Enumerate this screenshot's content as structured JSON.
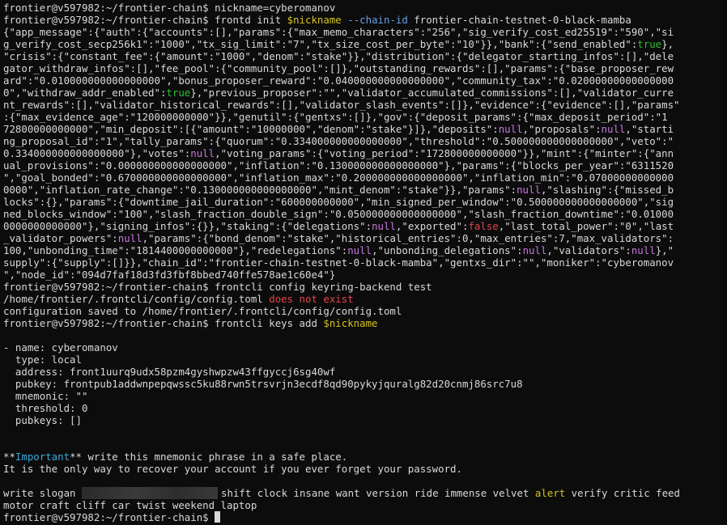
{
  "terminal": {
    "segments": [
      [
        "frontier@v597982:~/frontier-chain$ nickname=cyberomanov"
      ],
      [
        "frontier@v597982:~/frontier-chain$ frontd init ",
        {
          "t": "$nickname",
          "c": "var"
        },
        " ",
        {
          "t": "--chain-id",
          "c": "flag"
        },
        " frontier-chain-testnet-0-black-mamba"
      ],
      [
        "{\"app_message\":{\"auth\":{\"accounts\":[],\"params\":{\"max_memo_characters\":\"256\",\"sig_verify_cost_ed25519\":\"590\",\"si"
      ],
      [
        "g_verify_cost_secp256k1\":\"1000\",\"tx_sig_limit\":\"7\",\"tx_size_cost_per_byte\":\"10\"}},\"bank\":{\"send_enabled\":",
        {
          "t": "true",
          "c": "bool"
        },
        "},"
      ],
      [
        "\"crisis\":{\"constant_fee\":{\"amount\":\"1000\",\"denom\":\"stake\"}},\"distribution\":{\"delegator_starting_infos\":[],\"dele"
      ],
      [
        "gator_withdraw_infos\":[],\"fee_pool\":{\"community_pool\":[]},\"outstanding_rewards\":[],\"params\":{\"base_proposer_rew"
      ],
      [
        "ard\":\"0.010000000000000000\",\"bonus_proposer_reward\":\"0.040000000000000000\",\"community_tax\":\"0.02000000000000000"
      ],
      [
        "0\",\"withdraw_addr_enabled\":",
        {
          "t": "true",
          "c": "bool"
        },
        "},\"previous_proposer\":\"\",\"validator_accumulated_commissions\":[],\"validator_curre"
      ],
      [
        "nt_rewards\":[],\"validator_historical_rewards\":[],\"validator_slash_events\":[]},\"evidence\":{\"evidence\":[],\"params\""
      ],
      [
        ":{\"max_evidence_age\":\"120000000000\"}},\"genutil\":{\"gentxs\":[]},\"gov\":{\"deposit_params\":{\"max_deposit_period\":\"1"
      ],
      [
        "72800000000000\",\"min_deposit\":[{\"amount\":\"10000000\",\"denom\":\"stake\"}]},\"deposits\":",
        {
          "t": "null",
          "c": "nul"
        },
        ",\"proposals\":",
        {
          "t": "null",
          "c": "nul"
        },
        ",\"starti"
      ],
      [
        "ng_proposal_id\":\"1\",\"tally_params\":{\"quorum\":\"0.334000000000000000\",\"threshold\":\"0.500000000000000000\",\"veto\":\""
      ],
      [
        "0.334000000000000000\"},\"votes\":",
        {
          "t": "null",
          "c": "nul"
        },
        ",\"voting_params\":{\"voting_period\":\"172800000000000\"}},\"mint\":{\"minter\":{\"ann"
      ],
      [
        "ual_provisions\":\"0.000000000000000000\",\"inflation\":\"0.130000000000000000\"},\"params\":{\"blocks_per_year\":\"6311520"
      ],
      [
        "\",\"goal_bonded\":\"0.670000000000000000\",\"inflation_max\":\"0.200000000000000000\",\"inflation_min\":\"0.07000000000000"
      ],
      [
        "0000\",\"inflation_rate_change\":\"0.130000000000000000\",\"mint_denom\":\"stake\"}},\"params\":",
        {
          "t": "null",
          "c": "nul"
        },
        ",\"slashing\":{\"missed_b"
      ],
      [
        "locks\":{},\"params\":{\"downtime_jail_duration\":\"600000000000\",\"min_signed_per_window\":\"0.500000000000000000\",\"sig"
      ],
      [
        "ned_blocks_window\":\"100\",\"slash_fraction_double_sign\":\"0.050000000000000000\",\"slash_fraction_downtime\":\"0.01000"
      ],
      [
        "0000000000000\"},\"signing_infos\":{}},\"staking\":{\"delegations\":",
        {
          "t": "null",
          "c": "nul"
        },
        ",\"exported\":",
        {
          "t": "false",
          "c": "fals"
        },
        ",\"last_total_power\":\"0\",\"last"
      ],
      [
        "_validator_powers\":",
        {
          "t": "null",
          "c": "nul"
        },
        ",\"params\":{\"bond_denom\":\"stake\",\"historical_entries\":0,\"max_entries\":7,\"max_validators\":"
      ],
      [
        "100,\"unbonding_time\":\"1814400000000000\"},\"redelegations\":",
        {
          "t": "null",
          "c": "nul"
        },
        ",\"unbonding_delegations\":",
        {
          "t": "null",
          "c": "nul"
        },
        ",\"validators\":",
        {
          "t": "null",
          "c": "nul"
        },
        "},\""
      ],
      [
        "supply\":{\"supply\":[]}},\"chain_id\":\"frontier-chain-testnet-0-black-mamba\",\"gentxs_dir\":\"\",\"moniker\":\"cyberomanov"
      ],
      [
        "\",\"node_id\":\"094d7faf18d3fd3fbf8bbed740ffe578ae1c60e4\"}"
      ],
      [
        "frontier@v597982:~/frontier-chain$ frontcli config keyring-backend test"
      ],
      [
        "/home/frontier/.frontcli/config/config.toml ",
        {
          "t": "does not exist",
          "c": "err"
        }
      ],
      [
        "configuration saved to /home/frontier/.frontcli/config/config.toml"
      ],
      [
        "frontier@v597982:~/frontier-chain$ frontcli keys add ",
        {
          "t": "$nickname",
          "c": "var"
        }
      ],
      [
        ""
      ],
      [
        "- name: cyberomanov"
      ],
      [
        "  type: local"
      ],
      [
        "  address: front1uurq9udx58pzm4gyshwpzw43ffgyccj6sg40wf"
      ],
      [
        "  pubkey: frontpub1addwnpepqwssc5ku88rwn5trsvrjn3ecdf8qd90pykyjquralg82d20cnmj86src7u8"
      ],
      [
        "  mnemonic: \"\""
      ],
      [
        "  threshold: 0"
      ],
      [
        "  pubkeys: []"
      ],
      [
        ""
      ],
      [
        ""
      ],
      [
        "**",
        {
          "t": "Important",
          "c": "imp"
        },
        "** write this mnemonic phrase in a safe place."
      ],
      [
        "It is the only way to recover your account if you ever forget your password."
      ],
      [
        ""
      ],
      [
        "write slogan ",
        {
          "redact": true
        },
        "shift clock insane want version ride immense velvet ",
        {
          "t": "alert",
          "c": "var"
        },
        " verify critic feed"
      ],
      [
        "motor craft cliff car twist weekend laptop"
      ],
      [
        "frontier@v597982:~/frontier-chain$ ",
        {
          "cursor": true
        }
      ]
    ]
  }
}
